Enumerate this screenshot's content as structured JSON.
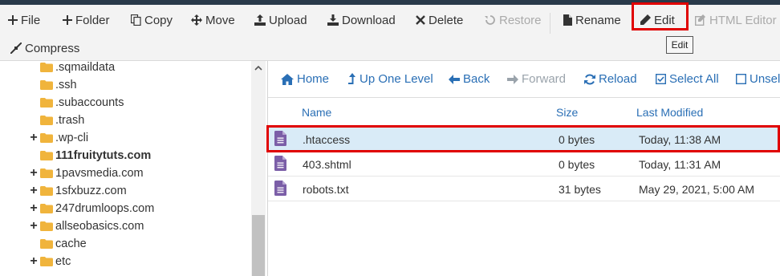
{
  "toolbar": {
    "file": "File",
    "folder": "Folder",
    "copy": "Copy",
    "move": "Move",
    "upload": "Upload",
    "download": "Download",
    "delete": "Delete",
    "restore": "Restore",
    "rename": "Rename",
    "edit": "Edit",
    "html_editor": "HTML Editor",
    "compress": "Compress",
    "tooltip": "Edit"
  },
  "tree": [
    {
      "label": ".sqmaildata",
      "expandable": false,
      "bold": false
    },
    {
      "label": ".ssh",
      "expandable": false,
      "bold": false
    },
    {
      "label": ".subaccounts",
      "expandable": false,
      "bold": false
    },
    {
      "label": ".trash",
      "expandable": false,
      "bold": false
    },
    {
      "label": ".wp-cli",
      "expandable": true,
      "bold": false
    },
    {
      "label": "111fruitytuts.com",
      "expandable": false,
      "bold": true
    },
    {
      "label": "1pavsmedia.com",
      "expandable": true,
      "bold": false
    },
    {
      "label": "1sfxbuzz.com",
      "expandable": true,
      "bold": false
    },
    {
      "label": "247drumloops.com",
      "expandable": true,
      "bold": false
    },
    {
      "label": "allseobasics.com",
      "expandable": true,
      "bold": false
    },
    {
      "label": "cache",
      "expandable": false,
      "bold": false
    },
    {
      "label": "etc",
      "expandable": true,
      "bold": false
    }
  ],
  "nav": {
    "home": "Home",
    "up_one_level": "Up One Level",
    "back": "Back",
    "forward": "Forward",
    "reload": "Reload",
    "select_all": "Select All",
    "unselect": "Unsele"
  },
  "columns": {
    "name": "Name",
    "size": "Size",
    "last_modified": "Last Modified"
  },
  "files": [
    {
      "name": ".htaccess",
      "size": "0 bytes",
      "modified": "Today, 11:38 AM",
      "selected": true
    },
    {
      "name": "403.shtml",
      "size": "0 bytes",
      "modified": "Today, 11:31 AM",
      "selected": false
    },
    {
      "name": "robots.txt",
      "size": "31 bytes",
      "modified": "May 29, 2021, 5:00 AM",
      "selected": false
    }
  ],
  "colors": {
    "accent": "#2a6fb5",
    "highlight": "#e00000",
    "folder": "#f0b43c",
    "file_icon": "#7b5ea7",
    "selected_row": "#d9ebf7"
  }
}
